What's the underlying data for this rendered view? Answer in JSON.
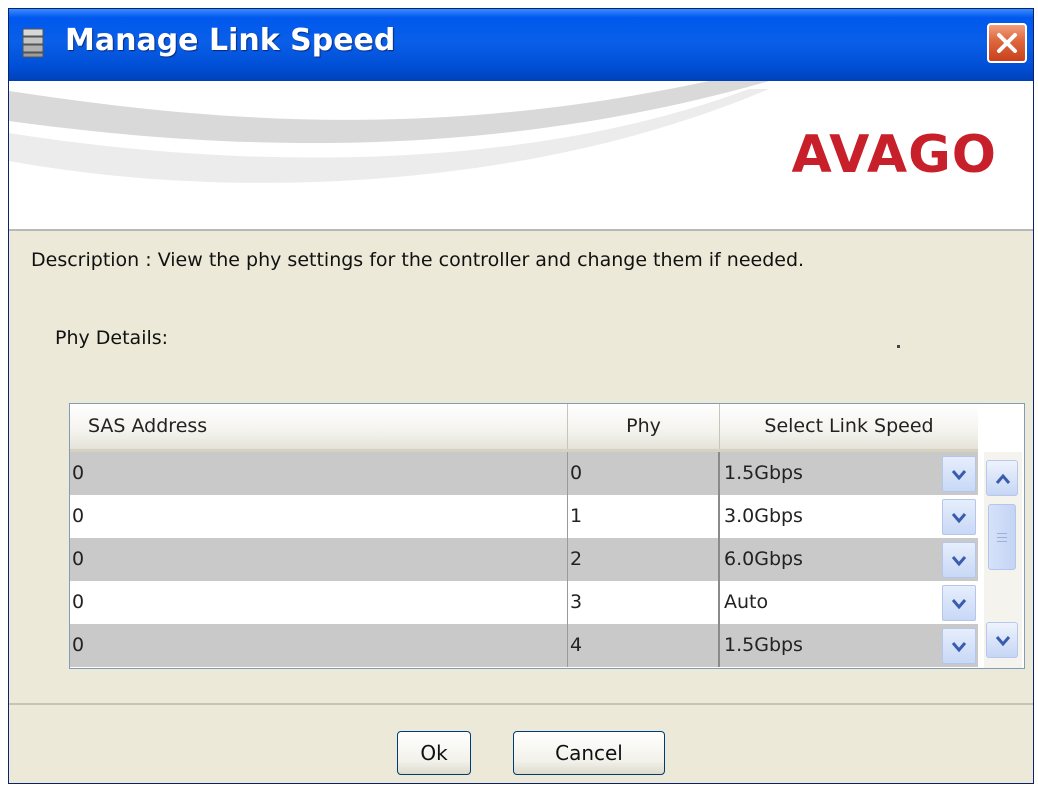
{
  "window": {
    "title": "Manage Link Speed",
    "icon": "server-stack-icon",
    "close_icon": "close-icon"
  },
  "banner": {
    "logo_text": "AVAGO",
    "logo_color": "#c8202a"
  },
  "description": "Description : View the phy settings for the controller and change them if needed.",
  "phy_details_label": "Phy Details:",
  "table": {
    "headers": [
      "SAS Address",
      "Phy",
      "Select Link Speed"
    ],
    "rows": [
      {
        "sas_address": "0",
        "phy": "0",
        "link_speed": "1.5Gbps"
      },
      {
        "sas_address": "0",
        "phy": "1",
        "link_speed": "3.0Gbps"
      },
      {
        "sas_address": "0",
        "phy": "2",
        "link_speed": "6.0Gbps"
      },
      {
        "sas_address": "0",
        "phy": "3",
        "link_speed": "Auto"
      },
      {
        "sas_address": "0",
        "phy": "4",
        "link_speed": "1.5Gbps"
      }
    ],
    "dropdown_icon": "chevron-down-icon",
    "scrollbar": {
      "up_icon": "chevron-up-icon",
      "down_icon": "chevron-down-icon"
    }
  },
  "buttons": {
    "ok": "Ok",
    "cancel": "Cancel"
  }
}
